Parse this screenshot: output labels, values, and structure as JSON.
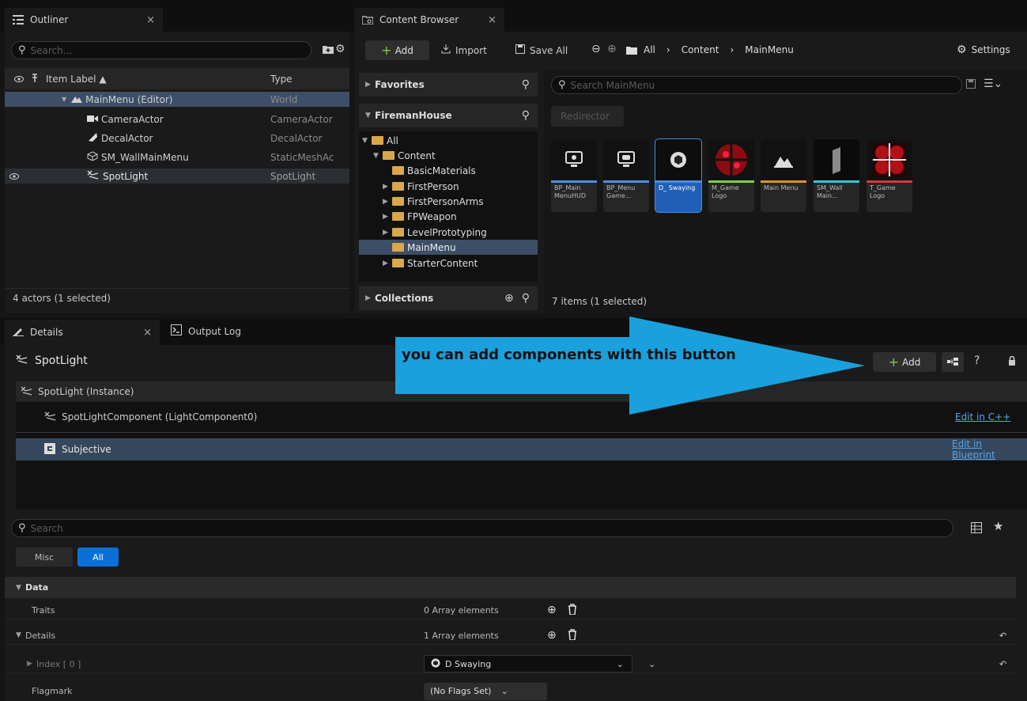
{
  "outliner": {
    "tab_label": "Outliner",
    "search_placeholder": "Search...",
    "col_label": "Item Label ▲",
    "col_type": "Type",
    "rows": [
      {
        "label": "MainMenu (Editor)",
        "type": "World"
      },
      {
        "label": "CameraActor",
        "type": "CameraActor"
      },
      {
        "label": "DecalActor",
        "type": "DecalActor"
      },
      {
        "label": "SM_WallMainMenu",
        "type": "StaticMeshAc"
      },
      {
        "label": "SpotLight",
        "type": "SpotLight"
      }
    ],
    "status": "4 actors (1 selected)"
  },
  "content_browser": {
    "tab_label": "Content Browser",
    "add_label": "Add",
    "import_label": "Import",
    "save_all_label": "Save All",
    "breadcrumb": [
      "All",
      "Content",
      "MainMenu"
    ],
    "settings_label": "Settings",
    "favorites_label": "Favorites",
    "project_label": "FiremanHouse",
    "tree": [
      {
        "label": "All",
        "depth": 0,
        "arrow": "▼",
        "open": true
      },
      {
        "label": "Content",
        "depth": 1,
        "arrow": "▼",
        "open": true
      },
      {
        "label": "BasicMaterials",
        "depth": 2,
        "arrow": ""
      },
      {
        "label": "FirstPerson",
        "depth": 2,
        "arrow": "▶"
      },
      {
        "label": "FirstPersonArms",
        "depth": 2,
        "arrow": "▶"
      },
      {
        "label": "FPWeapon",
        "depth": 2,
        "arrow": "▶"
      },
      {
        "label": "LevelPrototyping",
        "depth": 2,
        "arrow": "▶"
      },
      {
        "label": "MainMenu",
        "depth": 2,
        "arrow": "",
        "selected": true
      },
      {
        "label": "StarterContent",
        "depth": 2,
        "arrow": "▶"
      }
    ],
    "collections_label": "Collections",
    "search_placeholder": "Search MainMenu",
    "filter_chip": "Redirector",
    "assets": [
      {
        "label": "BP_Main MenuHUD",
        "color": "#4a8fe0"
      },
      {
        "label": "BP_Menu Game...",
        "color": "#4a8fe0"
      },
      {
        "label": "D_ Swaying",
        "color": "#4a8fe0",
        "selected": true
      },
      {
        "label": "M_Game Logo",
        "color": "#7fcf3f"
      },
      {
        "label": "Main Menu",
        "color": "#d9942b"
      },
      {
        "label": "SM_Wall Main...",
        "color": "#33c8d8"
      },
      {
        "label": "T_Game Logo",
        "color": "#d23a3a"
      }
    ],
    "status": "7 items (1 selected)"
  },
  "details": {
    "tab_label": "Details",
    "output_log_label": "Output Log",
    "actor_name": "SpotLight",
    "add_label": "Add",
    "instance_label": "SpotLight (Instance)",
    "component_label": "SpotLightComponent (LightComponent0)",
    "edit_cpp": "Edit in C++",
    "subjective_label": "Subjective",
    "edit_bp": "Edit in Blueprint",
    "search_placeholder": "Search",
    "filter_misc": "Misc",
    "filter_all": "All",
    "section_data": "Data",
    "props": {
      "traits_label": "Traits",
      "traits_value": "0 Array elements",
      "details_label": "Details",
      "details_value": "1 Array elements",
      "index_label": "Index [ 0 ]",
      "index_value": "D Swaying",
      "flagmark_label": "Flagmark",
      "flagmark_value": "(No Flags Set)"
    }
  },
  "annotation": {
    "text": "you can add components with this button",
    "color": "#1aa0dc"
  }
}
